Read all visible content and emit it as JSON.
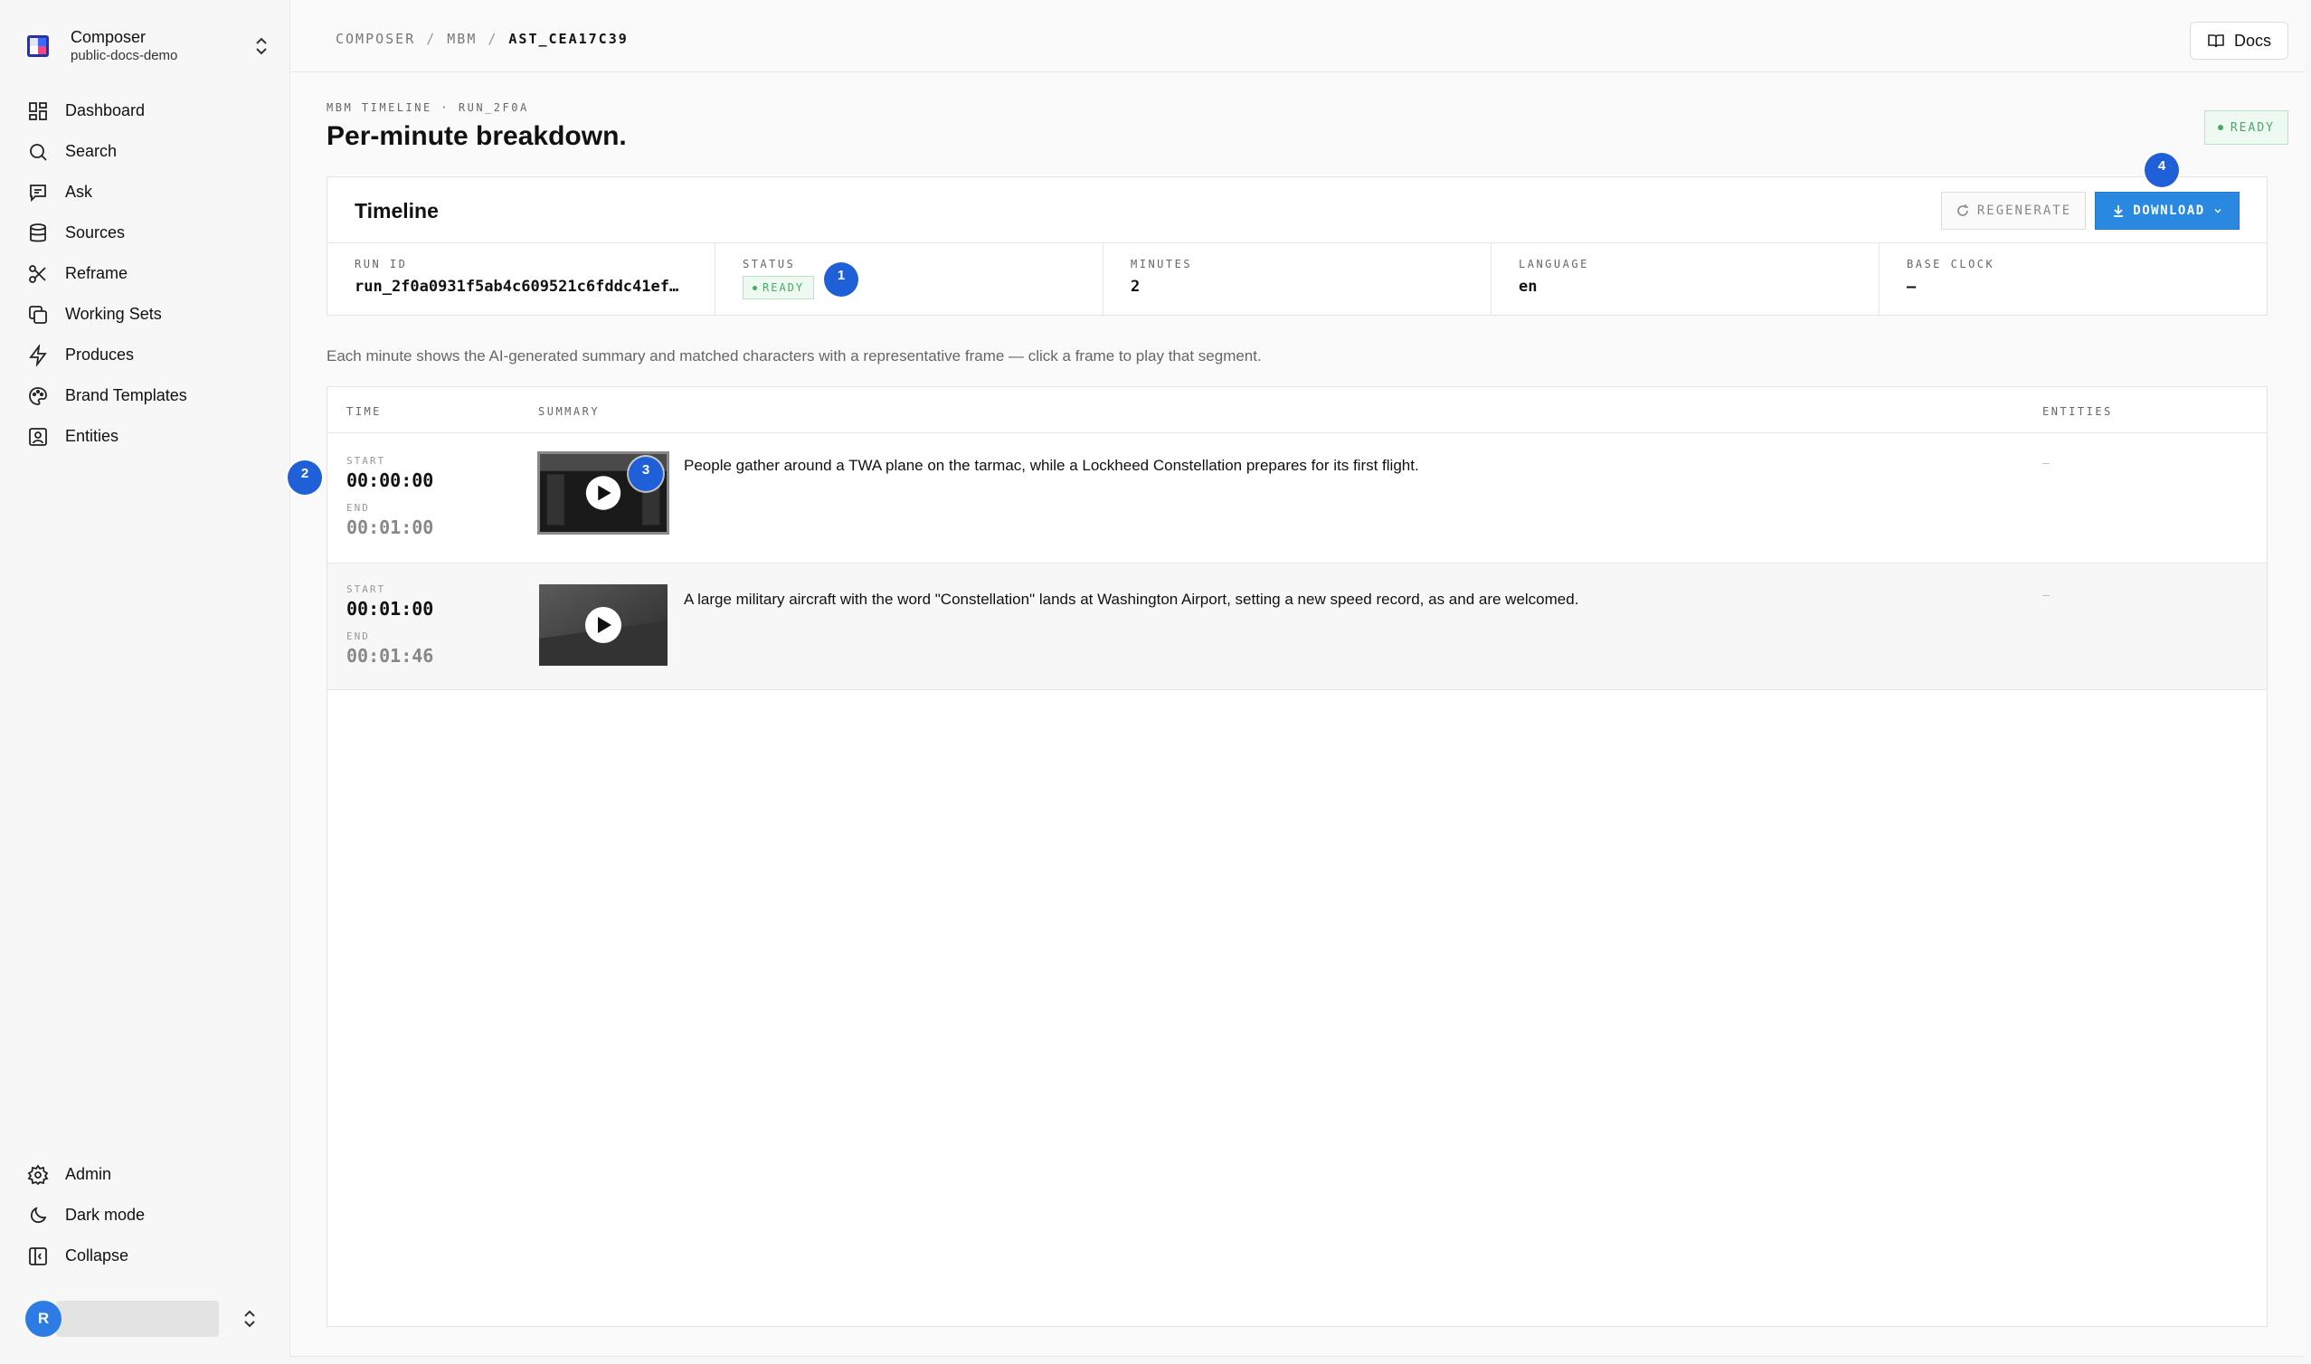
{
  "workspace": {
    "name": "Composer",
    "subtitle": "public-docs-demo"
  },
  "nav": {
    "items": [
      {
        "label": "Dashboard",
        "icon": "dashboard-icon"
      },
      {
        "label": "Search",
        "icon": "search-icon"
      },
      {
        "label": "Ask",
        "icon": "chat-icon"
      },
      {
        "label": "Sources",
        "icon": "database-icon"
      },
      {
        "label": "Reframe",
        "icon": "scissors-icon"
      },
      {
        "label": "Working Sets",
        "icon": "copy-icon"
      },
      {
        "label": "Produces",
        "icon": "lightning-icon"
      },
      {
        "label": "Brand Templates",
        "icon": "palette-icon"
      },
      {
        "label": "Entities",
        "icon": "person-card-icon"
      }
    ],
    "bottom": [
      {
        "label": "Admin",
        "icon": "gear-icon"
      },
      {
        "label": "Dark mode",
        "icon": "moon-icon"
      },
      {
        "label": "Collapse",
        "icon": "collapse-panel-icon"
      }
    ]
  },
  "user": {
    "initial": "R"
  },
  "breadcrumb": {
    "part1": "COMPOSER",
    "part2": "MBM",
    "current": "AST_CEA17C39",
    "sep": "/"
  },
  "docs_label": "Docs",
  "header": {
    "eyebrow": "MBM TIMELINE · RUN_2F0A",
    "title": "Per-minute breakdown.",
    "status": "READY"
  },
  "timeline": {
    "title": "Timeline",
    "regenerate_label": "REGENERATE",
    "download_label": "DOWNLOAD",
    "meta": {
      "run_id_label": "RUN ID",
      "run_id": "run_2f0a0931f5ab4c609521c6fddc41ef…",
      "status_label": "STATUS",
      "status": "READY",
      "minutes_label": "MINUTES",
      "minutes": "2",
      "language_label": "LANGUAGE",
      "language": "en",
      "base_clock_label": "BASE CLOCK",
      "base_clock": "—"
    }
  },
  "description": "Each minute shows the AI-generated summary and matched characters with a representative frame — click a frame to play that segment.",
  "table": {
    "headers": {
      "time": "TIME",
      "summary": "SUMMARY",
      "entities": "ENTITIES"
    },
    "start_label": "START",
    "end_label": "END",
    "rows": [
      {
        "start": "00:00:00",
        "end": "00:01:00",
        "summary": "People gather around a TWA plane on the tarmac, while a Lockheed Constellation prepares for its first flight.",
        "entities": "–"
      },
      {
        "start": "00:01:00",
        "end": "00:01:46",
        "summary": "A large military aircraft with the word \"Constellation\" lands at Washington Airport, setting a new speed record, as and are welcomed.",
        "entities": "–"
      }
    ]
  },
  "badges": [
    "1",
    "2",
    "3",
    "4"
  ],
  "colors": {
    "accent": "#2a88e0",
    "ready_green": "#48a866",
    "badge_blue": "#1f5fd8"
  }
}
